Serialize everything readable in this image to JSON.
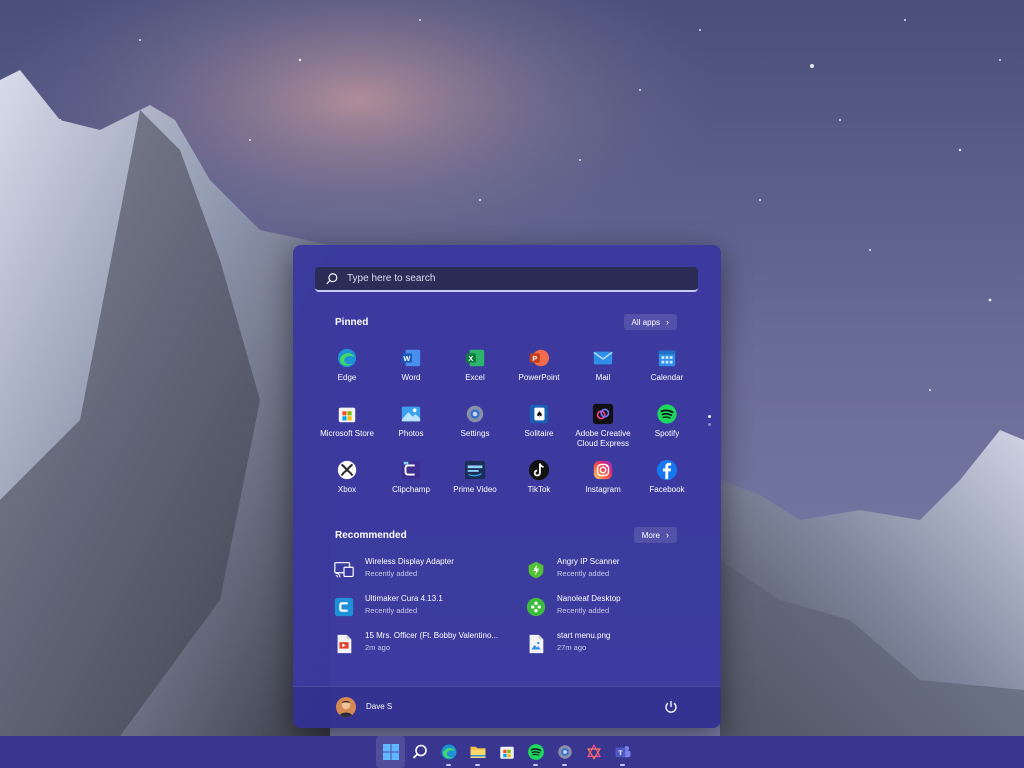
{
  "search": {
    "placeholder": "Type here to search"
  },
  "pinned": {
    "title": "Pinned",
    "all_apps_label": "All apps",
    "apps": [
      {
        "label": "Edge",
        "icon": "edge-icon"
      },
      {
        "label": "Word",
        "icon": "word-icon"
      },
      {
        "label": "Excel",
        "icon": "excel-icon"
      },
      {
        "label": "PowerPoint",
        "icon": "powerpoint-icon"
      },
      {
        "label": "Mail",
        "icon": "mail-icon"
      },
      {
        "label": "Calendar",
        "icon": "calendar-icon"
      },
      {
        "label": "Microsoft Store",
        "icon": "microsoft-store-icon"
      },
      {
        "label": "Photos",
        "icon": "photos-icon"
      },
      {
        "label": "Settings",
        "icon": "settings-icon"
      },
      {
        "label": "Solitaire",
        "icon": "solitaire-icon"
      },
      {
        "label": "Adobe Creative\nCloud Express",
        "icon": "adobe-express-icon"
      },
      {
        "label": "Spotify",
        "icon": "spotify-icon"
      },
      {
        "label": "Xbox",
        "icon": "xbox-icon"
      },
      {
        "label": "Clipchamp",
        "icon": "clipchamp-icon"
      },
      {
        "label": "Prime Video",
        "icon": "prime-video-icon"
      },
      {
        "label": "TikTok",
        "icon": "tiktok-icon"
      },
      {
        "label": "Instagram",
        "icon": "instagram-icon"
      },
      {
        "label": "Facebook",
        "icon": "facebook-icon"
      }
    ]
  },
  "recommended": {
    "title": "Recommended",
    "more_label": "More",
    "items": [
      {
        "name": "Wireless Display Adapter",
        "sub": "Recently added",
        "icon": "wireless-display-icon"
      },
      {
        "name": "Angry IP Scanner",
        "sub": "Recently added",
        "icon": "angry-ip-scanner-icon"
      },
      {
        "name": "Ultimaker Cura 4.13.1",
        "sub": "Recently added",
        "icon": "cura-icon"
      },
      {
        "name": "Nanoleaf Desktop",
        "sub": "Recently added",
        "icon": "nanoleaf-icon"
      },
      {
        "name": "15 Mrs. Officer (Ft. Bobby Valentino...",
        "sub": "2m ago",
        "icon": "audio-file-icon"
      },
      {
        "name": "start menu.png",
        "sub": "27m ago",
        "icon": "image-file-icon"
      }
    ]
  },
  "user": {
    "name": "Dave S"
  },
  "taskbar": {
    "icons": [
      "windows-start-icon",
      "search-icon",
      "edge-icon",
      "file-explorer-icon",
      "microsoft-store-icon",
      "spotify-icon",
      "settings-icon",
      "affinity-icon",
      "teams-icon"
    ]
  },
  "colors": {
    "menu_bg": "#3a389e",
    "taskbar_bg": "#38368e",
    "accent": "#c8ccff"
  }
}
